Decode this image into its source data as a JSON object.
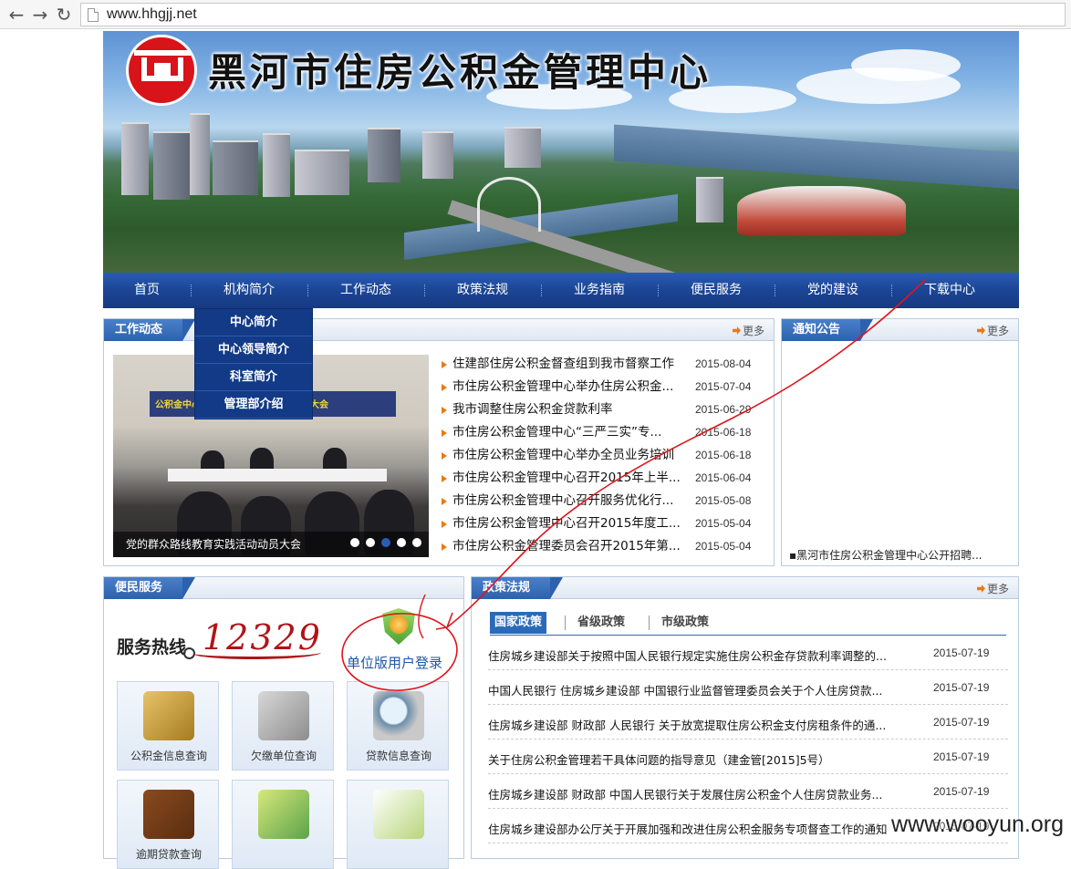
{
  "browser": {
    "back_icon": "back-arrow-icon",
    "forward_icon": "forward-arrow-icon",
    "reload_icon": "reload-icon",
    "url": "www.hhgjj.net"
  },
  "banner": {
    "title": "黑河市住房公积金管理中心"
  },
  "nav": {
    "items": [
      "首页",
      "机构简介",
      "工作动态",
      "政策法规",
      "业务指南",
      "便民服务",
      "党的建设",
      "下载中心"
    ],
    "dropdown": [
      "中心简介",
      "中心领导简介",
      "科室简介",
      "管理部介绍"
    ]
  },
  "work_news": {
    "title": "工作动态",
    "more": "更多",
    "photo_stage_text": "公积金中心",
    "photo_stage_text2": "大会",
    "photo_caption": "党的群众路线教育实践活动动员大会",
    "items": [
      {
        "title": "住建部住房公积金督查组到我市督察工作",
        "date": "2015-08-04"
      },
      {
        "title": "市住房公积金管理中心举办住房公积金...",
        "date": "2015-07-04"
      },
      {
        "title": "我市调整住房公积金贷款利率",
        "date": "2015-06-29"
      },
      {
        "title": "市住房公积金管理中心“三严三实”专...",
        "date": "2015-06-18"
      },
      {
        "title": "市住房公积金管理中心举办全员业务培训",
        "date": "2015-06-18"
      },
      {
        "title": "市住房公积金管理中心召开2015年上半...",
        "date": "2015-06-04"
      },
      {
        "title": "市住房公积金管理中心召开服务优化行...",
        "date": "2015-05-08"
      },
      {
        "title": "市住房公积金管理中心召开2015年度工...",
        "date": "2015-05-04"
      },
      {
        "title": "市住房公积金管理委员会召开2015年第...",
        "date": "2015-05-04"
      }
    ]
  },
  "notice": {
    "title": "通知公告",
    "more": "更多",
    "items": [
      "▪黑河市住房公积金管理中心公开招聘..."
    ]
  },
  "service": {
    "title": "便民服务",
    "hotline_label": "服务热线",
    "hotline_number": "12329",
    "login_link": "单位版用户登录",
    "tiles": [
      {
        "label": "公积金信息查询",
        "icon": "magnifier-document-icon"
      },
      {
        "label": "欠缴单位查询",
        "icon": "phone-calculator-icon"
      },
      {
        "label": "贷款信息查询",
        "icon": "magnifier-icon"
      },
      {
        "label": "逾期贷款查询",
        "icon": "wallet-icon"
      },
      {
        "label": "",
        "icon": "calculator-icon"
      },
      {
        "label": "",
        "icon": "form-pen-icon"
      }
    ]
  },
  "policy": {
    "title": "政策法规",
    "more": "更多",
    "tabs": [
      "国家政策",
      "省级政策",
      "市级政策"
    ],
    "items": [
      {
        "title": "住房城乡建设部关于按照中国人民银行规定实施住房公积金存贷款利率调整的...",
        "date": "2015-07-19"
      },
      {
        "title": "中国人民银行 住房城乡建设部 中国银行业监督管理委员会关于个人住房贷款...",
        "date": "2015-07-19"
      },
      {
        "title": "住房城乡建设部 财政部 人民银行 关于放宽提取住房公积金支付房租条件的通...",
        "date": "2015-07-19"
      },
      {
        "title": "关于住房公积金管理若干具体问题的指导意见（建金管[2015]5号）",
        "date": "2015-07-19"
      },
      {
        "title": "住房城乡建设部 财政部 中国人民银行关于发展住房公积金个人住房贷款业务...",
        "date": "2015-07-19"
      },
      {
        "title": "住房城乡建设部办公厅关于开展加强和改进住房公积金服务专项督查工作的通知",
        "date": "2015-07-19"
      }
    ]
  },
  "watermark": "www.wooyun.org",
  "colors": {
    "nav_blue": "#1b4595",
    "annotation_red": "#e0141c",
    "accent_orange": "#e77a12"
  }
}
